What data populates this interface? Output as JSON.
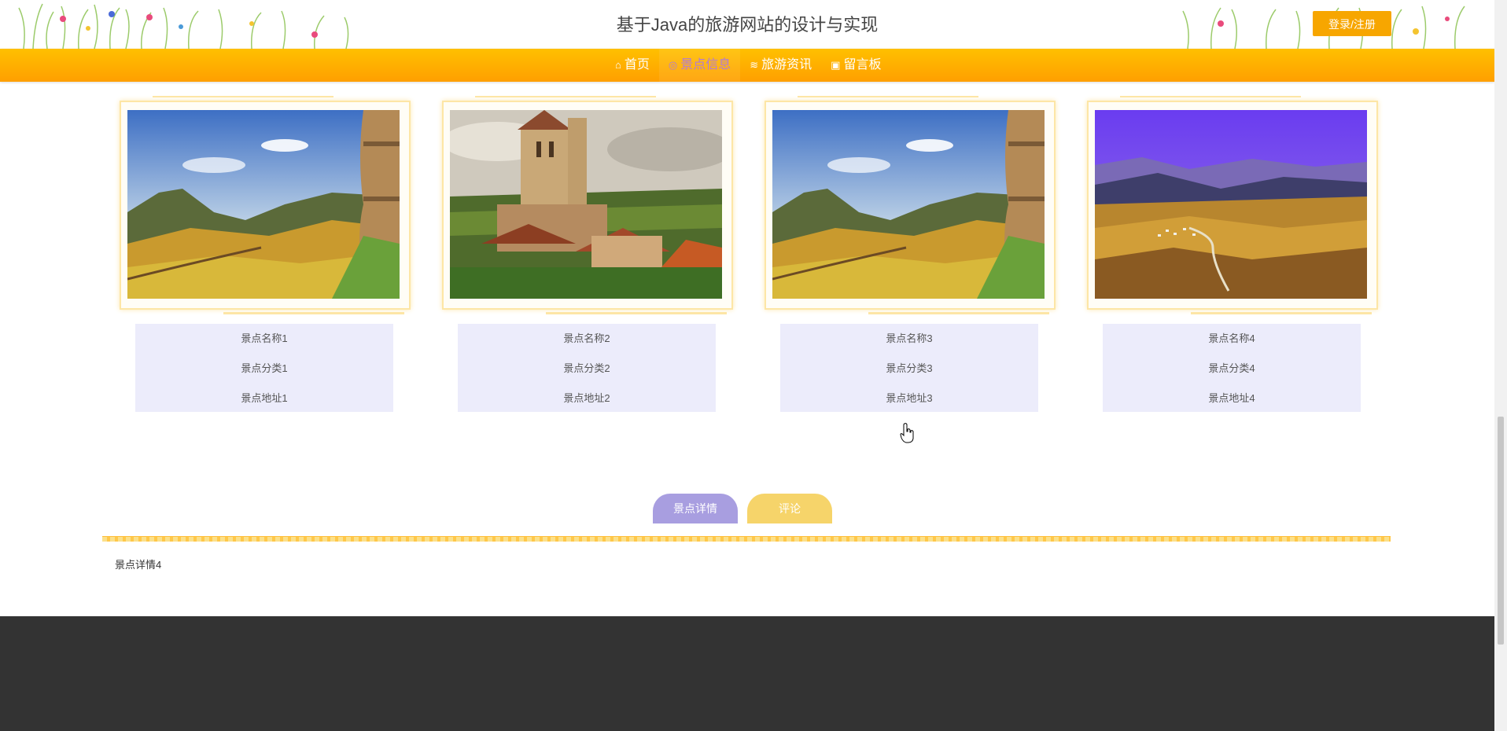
{
  "header": {
    "site_title": "基于Java的旅游网站的设计与实现",
    "login_label": "登录/注册"
  },
  "nav": {
    "items": [
      {
        "label": "首页",
        "icon": "home-icon"
      },
      {
        "label": "景点信息",
        "icon": "location-icon"
      },
      {
        "label": "旅游资讯",
        "icon": "layers-icon"
      },
      {
        "label": "留言板",
        "icon": "message-icon"
      }
    ],
    "active_index": 1
  },
  "cards": [
    {
      "name": "景点名称1",
      "category": "景点分类1",
      "address": "景点地址1",
      "image": "valley-with-tower"
    },
    {
      "name": "景点名称2",
      "category": "景点分类2",
      "address": "景点地址2",
      "image": "church-village"
    },
    {
      "name": "景点名称3",
      "category": "景点分类3",
      "address": "景点地址3",
      "image": "valley-with-tower"
    },
    {
      "name": "景点名称4",
      "category": "景点分类4",
      "address": "景点地址4",
      "image": "purple-sky-valley"
    }
  ],
  "tabs": {
    "detail_label": "景点详情",
    "comment_label": "评论"
  },
  "detail": {
    "text": "景点详情4"
  },
  "colors": {
    "nav_gradient_top": "#ffc000",
    "nav_gradient_bottom": "#ff9f00",
    "login_button": "#f7a600",
    "nav_active_text": "#b07bd6",
    "tab_detail": "#a89ee0",
    "tab_comment": "#f6d46a",
    "info_bg": "#ececfb",
    "footer": "#333333"
  }
}
